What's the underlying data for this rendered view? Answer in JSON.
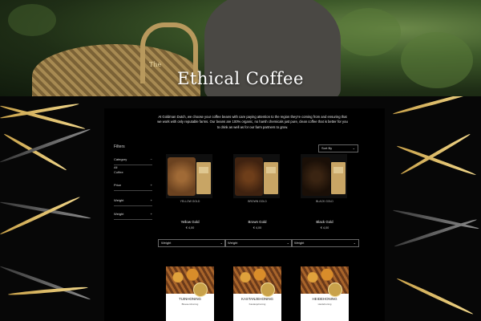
{
  "hero": {
    "title": "Ethical Coffee",
    "logo_text": "The"
  },
  "intro": {
    "text": "At Goldman Dutch, we choose your coffee beans with care paying attention to the region they're coming from and ensuring that we work with only reputable farms. Our beans are 100% organic, no harsh chemicals just pure, clean coffee that is better for you to drink as well as for our farm partners to grow."
  },
  "filters": {
    "title": "Filters",
    "category_label": "Category",
    "category_sub": "All",
    "category_sub2": "Coffee",
    "rows": [
      {
        "label": "Price",
        "sign": "+"
      },
      {
        "label": "Weight",
        "sign": "+"
      },
      {
        "label": "Weight",
        "sign": "+"
      }
    ]
  },
  "sort": {
    "label": "Sort By",
    "icon": "chevron-down-icon"
  },
  "products": [
    {
      "tag": "YELLOW GOLD",
      "name": "Yellow Gold",
      "price": "€ 4,00",
      "bean_color": "#8a5a2c"
    },
    {
      "tag": "BROWN GOLD",
      "name": "Brown Gold",
      "price": "€ 4,00",
      "bean_color": "#5a3216"
    },
    {
      "tag": "BLACK GOLD",
      "name": "Black Gold",
      "price": "€ 4,00",
      "bean_color": "#2a1a0e"
    }
  ],
  "weight_select": {
    "label": "Weight"
  },
  "honeys": [
    {
      "name": "TUINHONING",
      "desc": "Bloesemhoning"
    },
    {
      "name": "KASTANJEHONING",
      "desc": "Kastanjehoning"
    },
    {
      "name": "HEIDEHONING",
      "desc": "Heidehoning"
    }
  ],
  "colors": {
    "background": "#000000",
    "gold_accent": "#c9a24a"
  }
}
